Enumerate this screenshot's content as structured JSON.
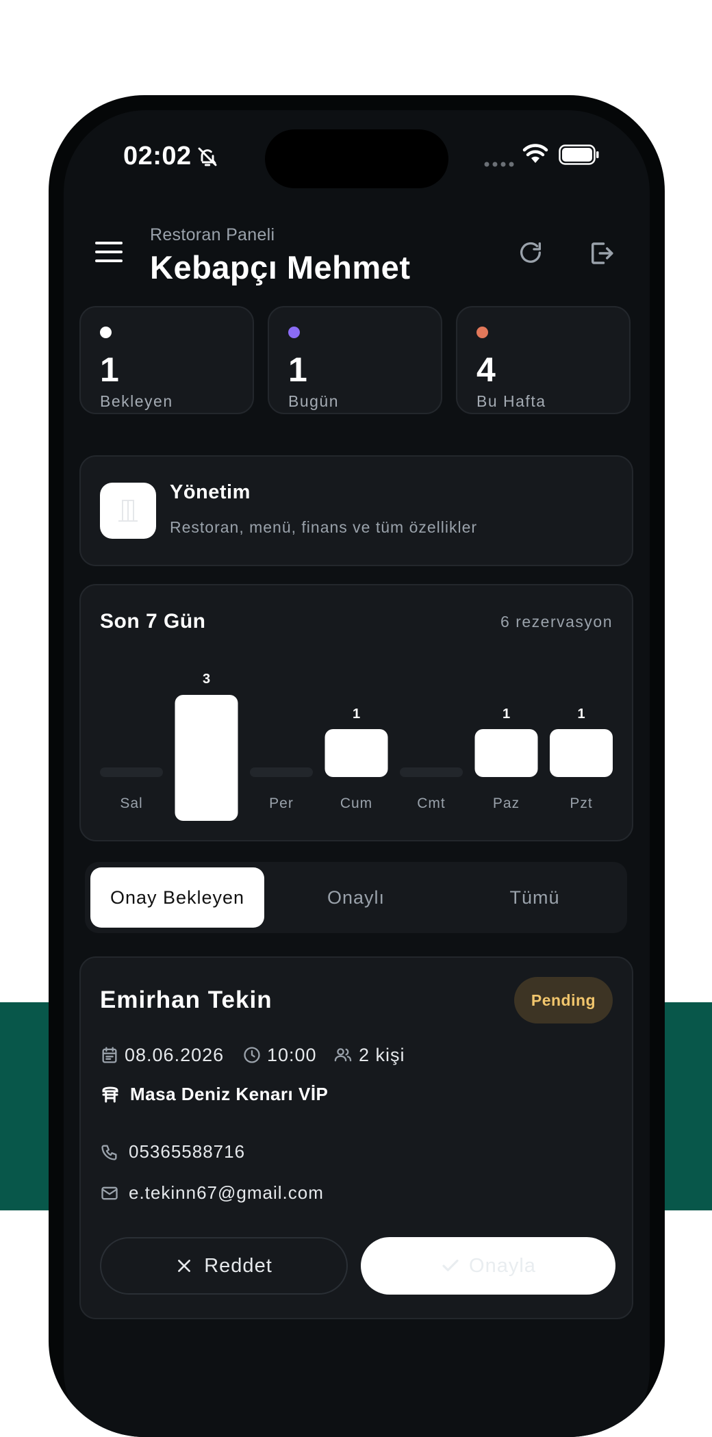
{
  "status_bar": {
    "time": "02:02"
  },
  "header": {
    "subtitle": "Restoran Paneli",
    "title": "Kebapçı Mehmet"
  },
  "stats": [
    {
      "value": "1",
      "label": "Bekleyen",
      "color": "#ffffff"
    },
    {
      "value": "1",
      "label": "Bugün",
      "color": "#8b6cf6"
    },
    {
      "value": "4",
      "label": "Bu Hafta",
      "color": "#e2785a"
    }
  ],
  "management": {
    "title": "Yönetim",
    "description": "Restoran, menü, finans ve tüm özellikler"
  },
  "chart_data": {
    "type": "bar",
    "title": "Son 7 Gün",
    "subtitle": "6 rezervasyon",
    "categories": [
      "Sal",
      "",
      "Per",
      "Cum",
      "Cmt",
      "Paz",
      "Pzt"
    ],
    "values": [
      0,
      3,
      0,
      1,
      0,
      1,
      1
    ],
    "ylim": [
      0,
      3
    ],
    "grid": false
  },
  "tabs": [
    {
      "label": "Onay Bekleyen",
      "active": true
    },
    {
      "label": "Onaylı",
      "active": false
    },
    {
      "label": "Tümü",
      "active": false
    }
  ],
  "reservation": {
    "name": "Emirhan Tekin",
    "status": "Pending",
    "date": "08.06.2026",
    "time": "10:00",
    "guests": "2 kişi",
    "table": "Masa Deniz Kenarı VİP",
    "phone": "05365588716",
    "email": "e.tekinn67@gmail.com",
    "reject_label": "Reddet",
    "approve_label": "Onayla"
  },
  "colors": {
    "background": "#0d1013",
    "card": "#16191d",
    "accent_green": "#08574a",
    "pending_text": "#f2c66d"
  }
}
